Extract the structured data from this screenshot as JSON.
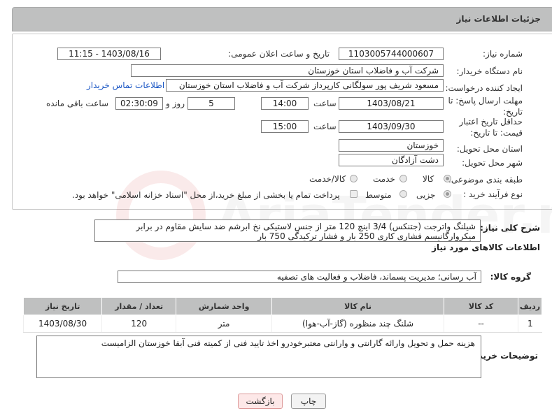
{
  "header": {
    "title": "جزئیات اطلاعات نیاز"
  },
  "form": {
    "need_number": {
      "label": "شماره نیاز:",
      "value": "1103005744000607"
    },
    "announce_datetime": {
      "label": "تاریخ و ساعت اعلان عمومی:",
      "value": "1403/08/16 - 11:15"
    },
    "buyer_org": {
      "label": "نام دستگاه خریدار:",
      "value": "شرکت آب و فاضلاب استان خوزستان"
    },
    "requester": {
      "label": "ایجاد کننده درخواست:",
      "value": "مسعود شریف پور سولگانی کارپرداز شرکت آب و فاضلاب استان خوزستان",
      "contact_link": "اطلاعات تماس خریدار"
    },
    "reply_deadline": {
      "label": "مهلت ارسال پاسخ: تا تاریخ:",
      "date": "1403/08/21",
      "time_label": "ساعت",
      "time": "14:00",
      "days": "5",
      "days_label": "روز و",
      "remaining": "02:30:09",
      "remaining_label": "ساعت باقی مانده"
    },
    "price_validity": {
      "label": "حداقل تاریخ اعتبار قیمت: تا تاریخ:",
      "date": "1403/09/30",
      "time_label": "ساعت",
      "time": "15:00"
    },
    "province": {
      "label": "استان محل تحویل:",
      "value": "خوزستان"
    },
    "city": {
      "label": "شهر محل تحویل:",
      "value": "دشت آزادگان"
    },
    "category": {
      "label": "طبقه بندی موضوعی:",
      "options": [
        "کالا",
        "خدمت",
        "کالا/خدمت"
      ],
      "selected": "کالا"
    },
    "purchase_type": {
      "label": "نوع فرآیند خرید :",
      "options": [
        "جزیی",
        "متوسط"
      ],
      "selected": "جزیی",
      "payment_note": "پرداخت تمام یا بخشی از مبلغ خرید،از محل \"اسناد خزانه اسلامی\" خواهد بود."
    }
  },
  "description": {
    "label": "شرح کلی نیاز:",
    "text": "شیلنگ واترجت (جتنکس) 3/4 اینچ 120 متر از جنس لاستیکی نخ ابرشم ضد سایش  مقاوم در برابر میکروارگانیسم فشاری کاری 250 بار و فشار ترکیدگی 750 بار"
  },
  "goods": {
    "section_title": "اطلاعات کالاهای مورد نیاز",
    "group_label": "گروه کالا:",
    "group_value": "آب رسانی؛ مدیریت پسماند، فاضلاب و فعالیت های تصفیه",
    "columns": [
      "ردیف",
      "کد کالا",
      "نام کالا",
      "واحد شمارش",
      "تعداد / مقدار",
      "تاریخ نیاز"
    ],
    "rows": [
      {
        "row": "1",
        "code": "--",
        "name": "شلنگ چند منظوره (گاز-آب-هوا)",
        "unit": "متر",
        "qty": "120",
        "date": "1403/08/30"
      }
    ]
  },
  "buyer_notes": {
    "label": "توضیحات خریدار:",
    "text": "هزینه حمل و تحویل وارائه گارانتی و وارانتی معتبرخودرو اخذ تایید فنی از کمیته فنی آبفا خوزستان الزامیست"
  },
  "buttons": {
    "print": "چاپ",
    "back": "بازگشت"
  },
  "watermark": "AriaTender.net",
  "colors": {
    "header_bg": "#bfc0c0",
    "link": "#1a56c4",
    "back_btn_bg": "#fde8e8"
  }
}
